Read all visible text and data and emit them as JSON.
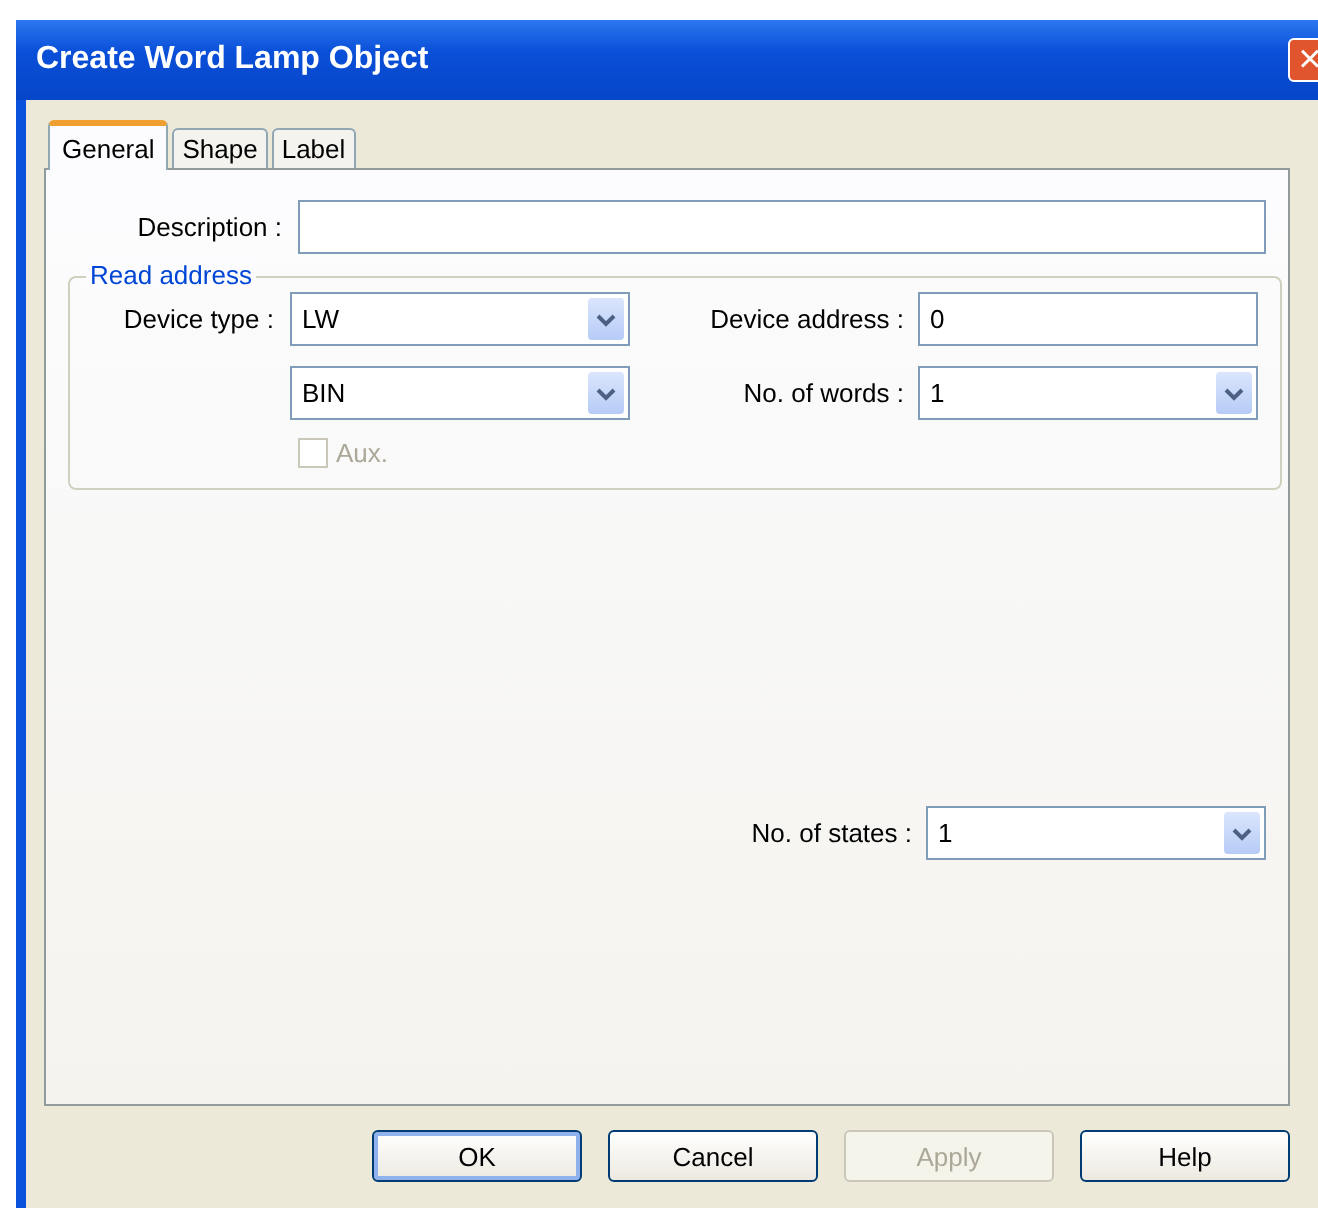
{
  "window": {
    "title": "Create Word Lamp Object",
    "close_label": "×"
  },
  "tabs": [
    {
      "label": "General",
      "selected": true
    },
    {
      "label": "Shape",
      "selected": false
    },
    {
      "label": "Label",
      "selected": false
    }
  ],
  "description": {
    "label": "Description :"
  },
  "read_address": {
    "legend": "Read address",
    "device_type": {
      "label": "Device type :",
      "value": "LW"
    },
    "device_address": {
      "label": "Device address :",
      "value": "0"
    },
    "format": {
      "value": "BIN"
    },
    "no_of_words": {
      "label": "No. of words :",
      "value": "1"
    },
    "aux": {
      "label": "Aux.",
      "checked": false,
      "disabled": true
    }
  },
  "no_of_states": {
    "label": "No. of states :",
    "value": "1"
  },
  "buttons": [
    {
      "label": "OK",
      "default": true,
      "disabled": false
    },
    {
      "label": "Cancel",
      "default": false,
      "disabled": false
    },
    {
      "label": "Apply",
      "default": false,
      "disabled": true
    },
    {
      "label": "Help",
      "default": false,
      "disabled": false
    }
  ]
}
